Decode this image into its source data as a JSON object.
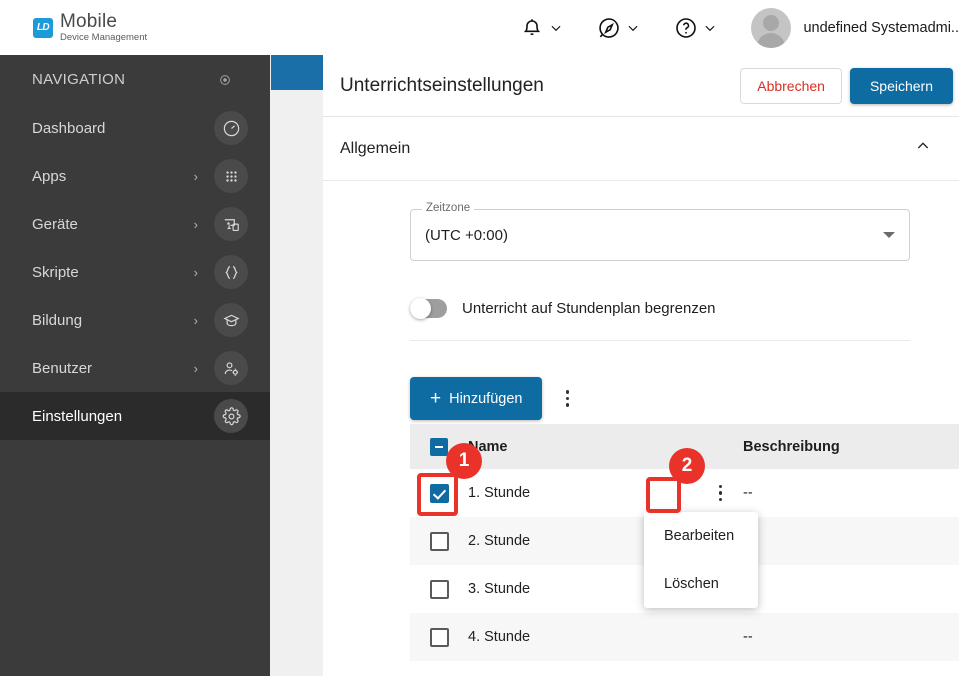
{
  "brand": {
    "mark": "LD",
    "title": "Mobile",
    "subtitle": "Device Management",
    "mark_color": "#1d9bd8"
  },
  "header": {
    "notifications_icon": "bell-icon",
    "explore_icon": "compass-icon",
    "help_icon": "help-circle-icon",
    "user_name": "undefined Systemadmi..",
    "avatar": "avatar-placeholder"
  },
  "sidebar": {
    "heading": "NAVIGATION",
    "pin_icon": "pin-target-icon",
    "items": [
      {
        "label": "Dashboard",
        "icon": "gauge-icon",
        "has_arrow": false,
        "selected": false
      },
      {
        "label": "Apps",
        "icon": "grid-apps-icon",
        "has_arrow": true,
        "selected": false
      },
      {
        "label": "Geräte",
        "icon": "devices-icon",
        "has_arrow": true,
        "selected": false
      },
      {
        "label": "Skripte",
        "icon": "braces-icon",
        "has_arrow": true,
        "selected": false
      },
      {
        "label": "Bildung",
        "icon": "graduation-icon",
        "has_arrow": true,
        "selected": false
      },
      {
        "label": "Benutzer",
        "icon": "user-settings-icon",
        "has_arrow": true,
        "selected": false
      },
      {
        "label": "Einstellungen",
        "icon": "gear-icon",
        "has_arrow": false,
        "selected": true
      }
    ],
    "arrow_glyph": "›"
  },
  "page": {
    "title": "Unterrichtseinstellungen",
    "cancel_label": "Abbrechen",
    "save_label": "Speichern",
    "cancel_color": "#d93025",
    "save_color": "#0e6ca3"
  },
  "section": {
    "title": "Allgemein",
    "collapse_icon": "chevron-up-icon"
  },
  "form": {
    "timezone": {
      "label": "Zeitzone",
      "value": "(UTC +0:00)",
      "dropdown_icon": "caret-down-icon"
    },
    "toggle": {
      "label": "Unterricht auf Stundenplan begrenzen",
      "state": "off"
    }
  },
  "toolbar": {
    "add_label": "Hinzufügen",
    "add_icon": "plus-icon",
    "overflow_icon": "kebab-menu-icon"
  },
  "table": {
    "columns": [
      "Name",
      "Beschreibung"
    ],
    "header_checkbox_state": "indeterminate",
    "rows": [
      {
        "checked": true,
        "name": "1. Stunde",
        "description": "--"
      },
      {
        "checked": false,
        "name": "2. Stunde",
        "description": ""
      },
      {
        "checked": false,
        "name": "3. Stunde",
        "description": ""
      },
      {
        "checked": false,
        "name": "4. Stunde",
        "description": "--"
      }
    ]
  },
  "context_menu": {
    "items": [
      "Bearbeiten",
      "Löschen"
    ]
  },
  "annotations": [
    {
      "number": "1",
      "target": "row-checkbox"
    },
    {
      "number": "2",
      "target": "row-kebab-menu"
    }
  ],
  "annotation_color": "#e8322a"
}
